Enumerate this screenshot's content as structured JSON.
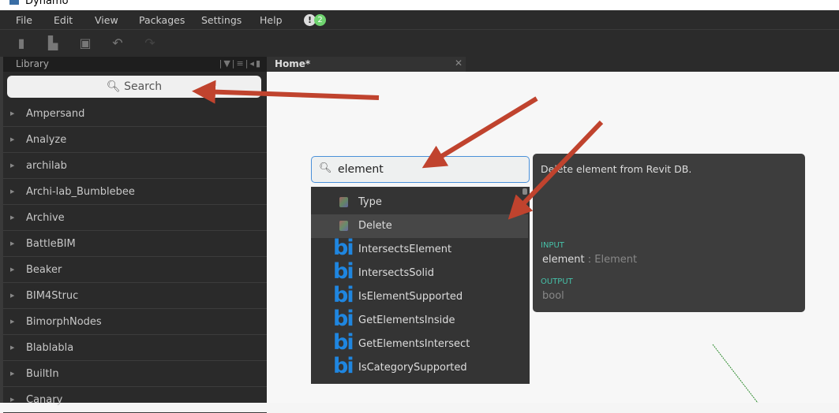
{
  "window": {
    "title": "Dynamo"
  },
  "menu": [
    "File",
    "Edit",
    "View",
    "Packages",
    "Settings",
    "Help"
  ],
  "notifications": {
    "alert": "!",
    "count": "2"
  },
  "toolbar": [
    "new-file-icon",
    "open-folder-icon",
    "save-icon",
    "undo-icon",
    "redo-icon"
  ],
  "library": {
    "title": "Library",
    "search_placeholder": "Search",
    "items": [
      "Ampersand",
      "Analyze",
      "archilab",
      "Archi-lab_Bumblebee",
      "Archive",
      "BattleBIM",
      "Beaker",
      "BIM4Struc",
      "BimorphNodes",
      "Blablabla",
      "BuiltIn",
      "Canary"
    ]
  },
  "tab": {
    "label": "Home*",
    "close": "✕"
  },
  "node_search": {
    "value": "element",
    "results": [
      {
        "label": "Type",
        "icon": "revit-cube-icon",
        "highlight": false
      },
      {
        "label": "Delete",
        "icon": "revit-cube-icon",
        "highlight": true
      },
      {
        "label": "IntersectsElement",
        "icon": "bimorph-bi-icon"
      },
      {
        "label": "IntersectsSolid",
        "icon": "bimorph-bi-icon"
      },
      {
        "label": "IsElementSupported",
        "icon": "bimorph-bi-icon"
      },
      {
        "label": "GetElementsInside",
        "icon": "bimorph-bi-icon"
      },
      {
        "label": "GetElementsIntersect",
        "icon": "bimorph-bi-icon"
      },
      {
        "label": "IsCategorySupported",
        "icon": "bimorph-bi-icon"
      }
    ]
  },
  "tooltip": {
    "description": "Delete element from Revit DB.",
    "input_header": "INPUT",
    "input_name": "element",
    "input_sep": " : ",
    "input_type": "Element",
    "output_header": "OUTPUT",
    "output_type": "bool"
  },
  "annotation_color": "#c0432e"
}
